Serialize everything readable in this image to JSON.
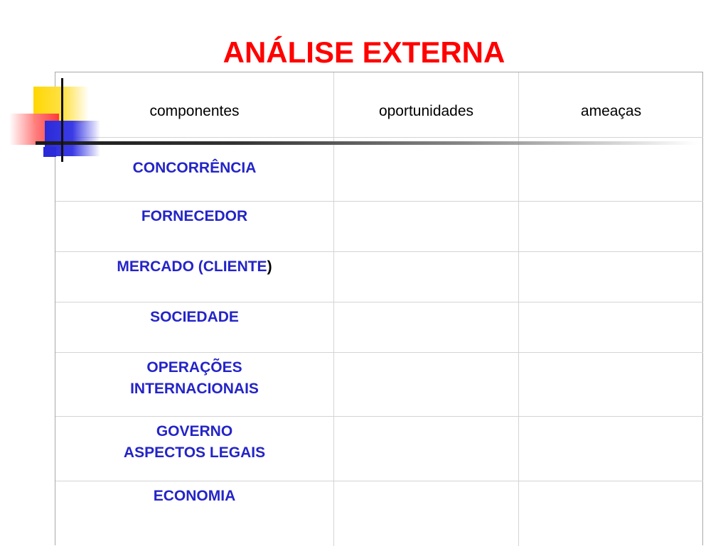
{
  "slide": {
    "title": "ANÁLISE EXTERNA"
  },
  "table": {
    "headers": [
      "componentes",
      "oportunidades",
      "ameaças"
    ],
    "rows": [
      {
        "line1": "CONCORRÊNCIA",
        "line2": ""
      },
      {
        "line1": "FORNECEDOR",
        "line2": ""
      },
      {
        "line1": "MERCADO (CLIENTE",
        "paren": ")",
        "line2": ""
      },
      {
        "line1": "SOCIEDADE",
        "line2": ""
      },
      {
        "line1": "OPERAÇÕES",
        "line2": "INTERNACIONAIS"
      },
      {
        "line1": "GOVERNO",
        "line2": "ASPECTOS LEGAIS"
      },
      {
        "line1": "ECONOMIA",
        "line2": ""
      }
    ]
  },
  "colors": {
    "title": "#ff0000",
    "component_text": "#2424c8",
    "header_text": "#000000",
    "grid": "#d4d4d4"
  }
}
